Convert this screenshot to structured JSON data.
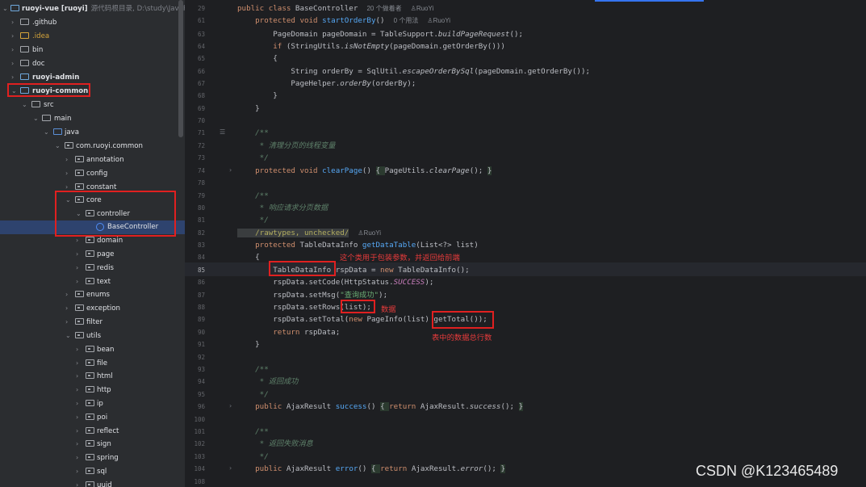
{
  "tree": {
    "root": {
      "name": "ruoyi-vue [ruoyi]",
      "sub": "源代码根目录, D:\\study\\JavaProj"
    },
    "items": [
      {
        "label": ".github",
        "bold": false
      },
      {
        "label": ".idea",
        "bold": false,
        "color": "#d5a43a"
      },
      {
        "label": "bin",
        "bold": false
      },
      {
        "label": "doc",
        "bold": false
      },
      {
        "label": "ruoyi-admin",
        "bold": true
      },
      {
        "label": "ruoyi-common",
        "bold": true
      },
      {
        "label": "src"
      },
      {
        "label": "main"
      },
      {
        "label": "java"
      },
      {
        "label": "com.ruoyi.common"
      },
      {
        "label": "annotation"
      },
      {
        "label": "config"
      },
      {
        "label": "constant"
      },
      {
        "label": "core"
      },
      {
        "label": "controller"
      },
      {
        "label": "BaseController"
      },
      {
        "label": "domain"
      },
      {
        "label": "page"
      },
      {
        "label": "redis"
      },
      {
        "label": "text"
      },
      {
        "label": "enums"
      },
      {
        "label": "exception"
      },
      {
        "label": "filter"
      },
      {
        "label": "utils"
      },
      {
        "label": "bean"
      },
      {
        "label": "file"
      },
      {
        "label": "html"
      },
      {
        "label": "http"
      },
      {
        "label": "ip"
      },
      {
        "label": "poi"
      },
      {
        "label": "reflect"
      },
      {
        "label": "sign"
      },
      {
        "label": "spring"
      },
      {
        "label": "sql"
      },
      {
        "label": "uuid"
      }
    ]
  },
  "editor": {
    "gutter": [
      "29",
      "61",
      "63",
      "64",
      "65",
      "66",
      "67",
      "68",
      "69",
      "70",
      "71",
      "72",
      "73",
      "74",
      "78",
      "79",
      "80",
      "81",
      "",
      "82",
      "83",
      "84",
      "85",
      "86",
      "87",
      "88",
      "89",
      "90",
      "91",
      "92",
      "93",
      "94",
      "95",
      "96",
      "100",
      "101",
      "102",
      "103",
      "104",
      "108"
    ],
    "inlay_authors": "20 个做着者",
    "inlay_author": "RuoYi",
    "inlay_usages": "0 个用法",
    "inlay_author2": "RuoYi",
    "inlay_author3": "RuoYi"
  },
  "code": {
    "l29a": "public class ",
    "l29b": "BaseController",
    "l61a": "    protected void ",
    "l61b": "startOrderBy",
    "l61c": "()",
    "l63": "        PageDomain pageDomain = TableSupport.",
    "l63i": "buildPageRequest",
    "l63e": "();",
    "l64a": "        if ",
    "l64b": "(StringUtils.",
    "l64i": "isNotEmpty",
    "l64e": "(pageDomain.getOrderBy()))",
    "l65": "        {",
    "l66a": "            String orderBy = SqlUtil.",
    "l66i": "escapeOrderBySql",
    "l66e": "(pageDomain.getOrderBy());",
    "l67a": "            PageHelper.",
    "l67i": "orderBy",
    "l67e": "(orderBy);",
    "l68": "        }",
    "l69": "    }",
    "l71": "    /**",
    "l72": "     * 清理分页的线程变量",
    "l73": "     */",
    "l74a": "    protected void ",
    "l74b": "clearPage",
    "l74c": "() ",
    "l74d": "{ ",
    "l74e": "PageUtils.",
    "l74i": "clearPage",
    "l74f": "(); ",
    "l74g": "}",
    "l79": "    /**",
    "l80": "     * 响应请求分页数据",
    "l81": "     */",
    "l81a": "    @SuppressWarnings(",
    "l81b": "\"rawtypes\", \"unchecked\"",
    "l81c": ")",
    "l82": "    /rawtypes, unchecked/",
    "l83a": "    protected ",
    "l83b": "TableDataInfo ",
    "l83c": "getDataTable",
    "l83d": "(List<?> list)",
    "l84": "    {",
    "l85a": "        TableDataInfo",
    "l85b": " rspData = ",
    "l85c": "new ",
    "l85d": "TableDataInfo();",
    "l86a": "        rspData.setCode(HttpStatus.",
    "l86i": "SUCCESS",
    "l86e": ");",
    "l87a": "        rspData.setMsg(",
    "l87s": "\"查询成功\"",
    "l87e": ");",
    "l88a": "        rspData.setRows(",
    "l88b": "list);",
    "l89a": "        rspData.setTotal(",
    "l89b": "new ",
    "l89c": "PageInfo(list) ",
    "l89d": "getTotal());",
    "l90a": "        return ",
    "l90b": "rspData;",
    "l91": "    }",
    "l93": "    /**",
    "l94": "     * 返回成功",
    "l95": "     */",
    "l96a": "    public ",
    "l96b": "AjaxResult ",
    "l96c": "success",
    "l96d": "() ",
    "l96e": "{ ",
    "l96f": "return ",
    "l96g": "AjaxResult.",
    "l96i": "success",
    "l96h": "(); ",
    "l96j": "}",
    "l101": "    /**",
    "l102": "     * 返回失败消息",
    "l103": "     */",
    "l104a": "    public ",
    "l104b": "AjaxResult ",
    "l104c": "error",
    "l104d": "() ",
    "l104e": "{ ",
    "l104f": "return ",
    "l104g": "AjaxResult.",
    "l104i": "error",
    "l104h": "(); ",
    "l104j": "}"
  },
  "annotations": {
    "note1": "这个类用于包装参数，并返回给前端",
    "note2": "数据",
    "note3": "表中的数据总行数"
  },
  "watermark": "CSDN @K123465489",
  "colors": {
    "highlight_box": "#e02020",
    "note_text": "#e53b3b",
    "selection": "#2e436e"
  }
}
